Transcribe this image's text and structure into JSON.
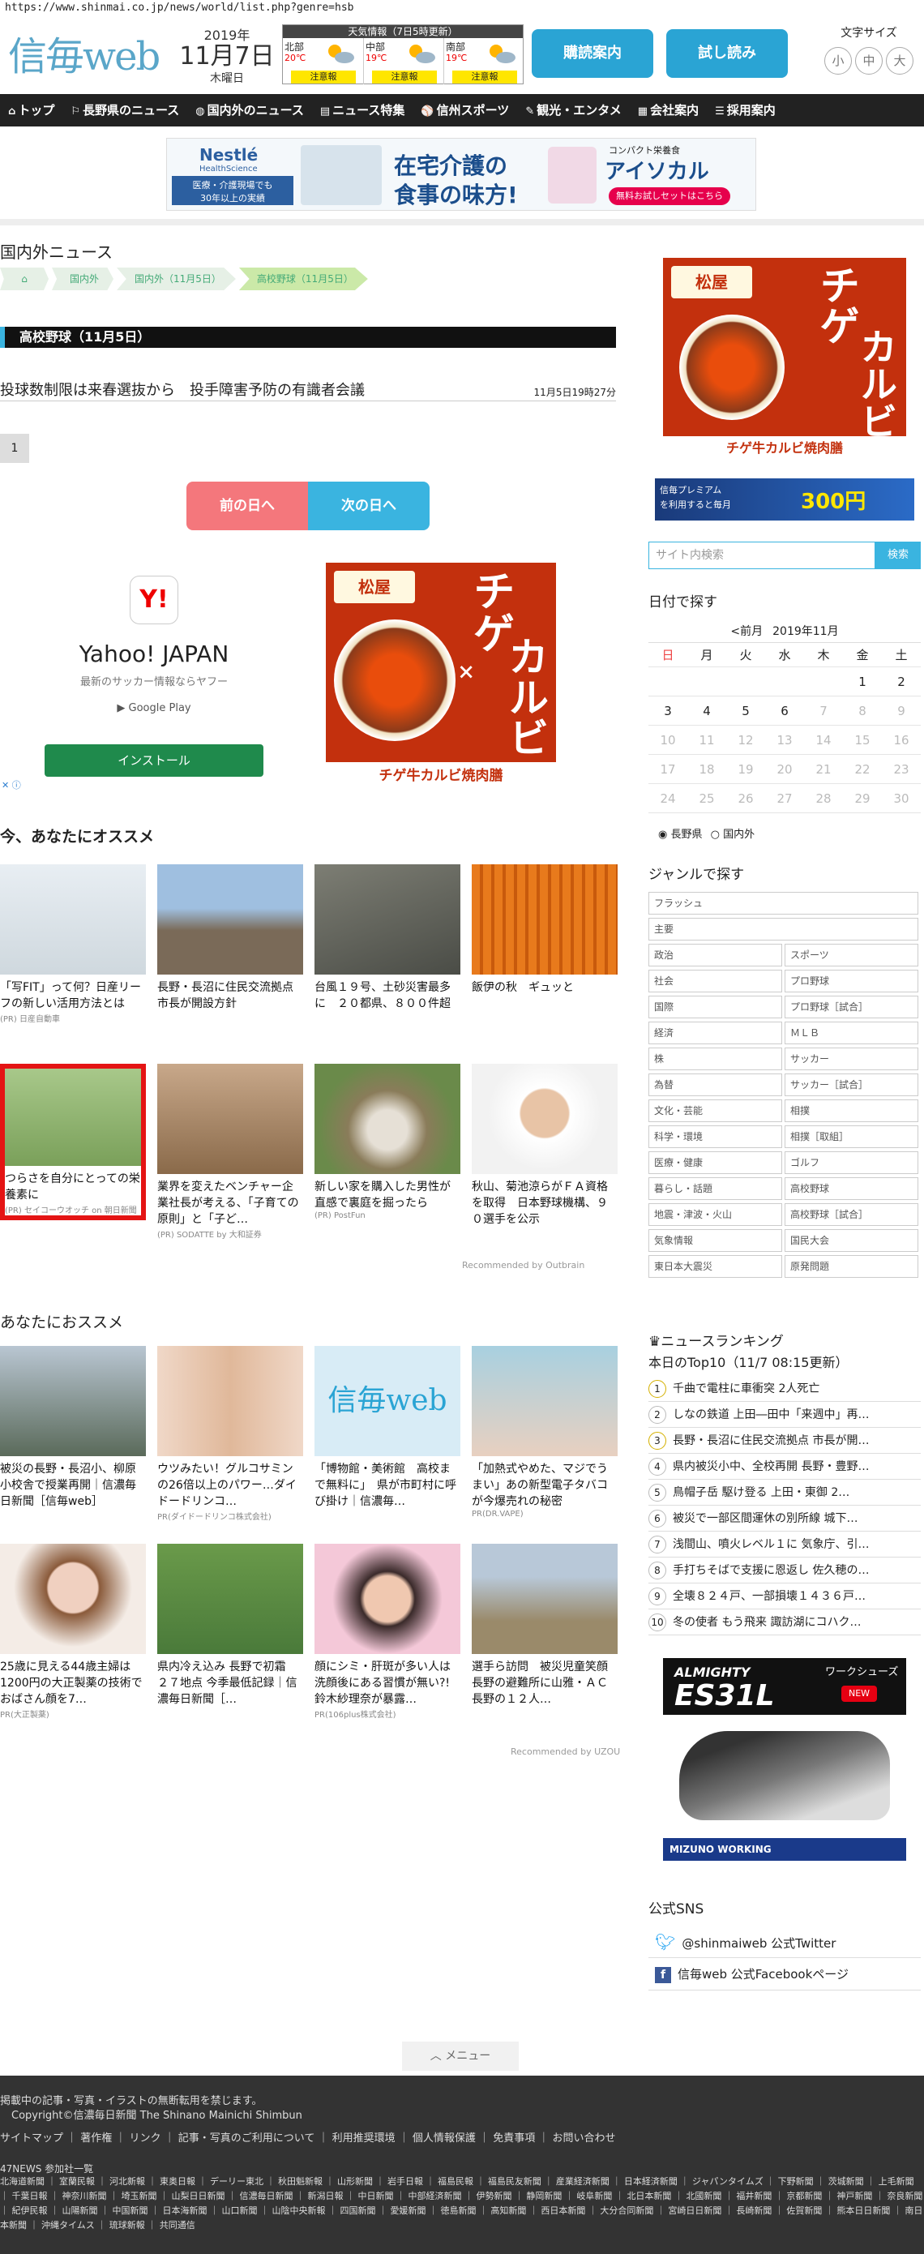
{
  "url": "https://www.shinmai.co.jp/news/world/list.php?genre=hsb",
  "header": {
    "logo": "信毎web",
    "year": "2019年",
    "date": "11月7日",
    "weekday": "木曜日",
    "weather_title": "天気情報（7日5時更新）",
    "regions": [
      {
        "name": "北部",
        "temp": "20℃",
        "warn": "注意報"
      },
      {
        "name": "中部",
        "temp": "19℃",
        "warn": "注意報"
      },
      {
        "name": "南部",
        "temp": "19℃",
        "warn": "注意報"
      }
    ],
    "btn_subscribe": "購読案内",
    "btn_trial": "試し読み",
    "font_label": "文字サイズ",
    "font_sizes": [
      "小",
      "中",
      "大"
    ]
  },
  "nav": [
    {
      "icon": "home-icon",
      "glyph": "⌂",
      "label": "トップ"
    },
    {
      "icon": "pin-icon",
      "glyph": "⚐",
      "label": "長野県のニュース"
    },
    {
      "icon": "globe-icon",
      "glyph": "◍",
      "label": "国内外のニュース"
    },
    {
      "icon": "doc-icon",
      "glyph": "▤",
      "label": "ニュース特集"
    },
    {
      "icon": "baseball-icon",
      "glyph": "⚾",
      "label": "信州スポーツ"
    },
    {
      "icon": "tour-icon",
      "glyph": "✎",
      "label": "観光・エンタメ"
    },
    {
      "icon": "building-icon",
      "glyph": "▦",
      "label": "会社案内"
    },
    {
      "icon": "recruit-icon",
      "glyph": "☰",
      "label": "採用案内"
    }
  ],
  "top_ad": {
    "brand": "Nestlé",
    "sub": "HealthScience",
    "tag1": "医療・介護現場でも",
    "tag2": "30年以上の実績",
    "headline1": "在宅介護の",
    "headline2": "食事の味方!",
    "product_tag": "コンパクト栄養食",
    "product": "アイソカル",
    "cta": "無料お試しセットはこちら"
  },
  "section_title": "国内外ニュース",
  "breadcrumbs": [
    "トップ",
    "国内外",
    "国内外（11月5日）",
    "高校野球（11月5日）"
  ],
  "category_bar": "高校野球（11月5日）",
  "article": {
    "title": "投球数制限は来春選抜から　投手障害予防の有識者会議",
    "datetime": "11月5日19時27分"
  },
  "pagination": [
    "1"
  ],
  "day_nav": {
    "prev": "前の日へ",
    "next": "次の日へ"
  },
  "yahoo_ad": {
    "logo": "Y!",
    "name": "Yahoo! JAPAN",
    "sub": "最新のサッカー情報ならヤフー",
    "store": "▶ Google Play",
    "install": "インストール"
  },
  "matsuya_ad": {
    "logo": "松屋",
    "big1": "チゲ",
    "big2": "カルビ",
    "x": "×",
    "banner": "チゲ牛カルビ焼肉膳"
  },
  "osusume": {
    "title": "今、あなたにオススメ",
    "cards": [
      {
        "title": "「写FIT」って何？日産リーフの新しい活用方法とは",
        "pr": "(PR) 日産自動車"
      },
      {
        "title": "長野・長沼に住民交流拠点　市長が開設方針",
        "pr": ""
      },
      {
        "title": "台風１９号、土砂災害最多に　２０都県、８００件超",
        "pr": ""
      },
      {
        "title": "飯伊の秋　ギュッと",
        "pr": ""
      },
      {
        "title": "つらさを自分にとっての栄養素に",
        "pr": "(PR) セイコーウオッチ on 朝日新聞"
      },
      {
        "title": "業界を変えたベンチャー企業社長が考える、「子育ての原則」と「子ど…",
        "pr": "(PR) SODATTE by 大和証券"
      },
      {
        "title": "新しい家を購入した男性が直感で裏庭を掘ったら",
        "pr": "(PR) PostFun"
      },
      {
        "title": "秋山、菊池涼らがＦＡ資格を取得　日本野球機構、９０選手を公示",
        "pr": ""
      }
    ],
    "recommended_by": "Recommended by Outbrain"
  },
  "anata": {
    "title": "あなたにおススメ",
    "cards": [
      {
        "title": "被災の長野・長沼小、柳原小校舎で授業再開｜信濃毎日新聞［信毎web］",
        "pr": ""
      },
      {
        "title": "ウツみたい！グルコサミンの26倍以上のパワー…ダイドードリンコ…",
        "pr": "PR(ダイドードリンコ株式会社)"
      },
      {
        "title": "「博物館・美術館　高校まで無料に」　県が市町村に呼び掛け｜信濃毎…",
        "pr": ""
      },
      {
        "title": "「加熱式やめた、マジでうまい」あの新型電子タバコが今爆売れの秘密",
        "pr": "PR(DR.VAPE)"
      },
      {
        "title": "25歳に見える44歳主婦は1200円の大正製薬の技術でおばさん顔を7…",
        "pr": "PR(大正製薬)"
      },
      {
        "title": "県内冷え込み 長野で初霜　２７地点 今季最低記録｜信濃毎日新聞［…",
        "pr": ""
      },
      {
        "title": "顔にシミ・肝斑が多い人は洗顔後にある習慣が無い?!鈴木紗理奈が暴露…",
        "pr": "PR(106plus株式会社)"
      },
      {
        "title": "選手ら訪問　被災児童笑顔　長野の避難所に山雅・ＡＣ長野の１２人…",
        "pr": ""
      }
    ],
    "recommended_by": "Recommended by UZOU"
  },
  "side": {
    "premium": {
      "text": "信毎プレミアム",
      "sub": "を利用すると毎月",
      "amount": "300円"
    },
    "search_placeholder": "サイト内検索",
    "search_btn": "検索",
    "cal_title": "日付で探す",
    "cal_prev": "<前月",
    "cal_month": "2019年11月",
    "weekdays": [
      "日",
      "月",
      "火",
      "水",
      "木",
      "金",
      "土"
    ],
    "weeks": [
      [
        "",
        "",
        "",
        "",
        "",
        "1",
        "2"
      ],
      [
        "3",
        "4",
        "5",
        "6",
        "7",
        "8",
        "9"
      ],
      [
        "10",
        "11",
        "12",
        "13",
        "14",
        "15",
        "16"
      ],
      [
        "17",
        "18",
        "19",
        "20",
        "21",
        "22",
        "23"
      ],
      [
        "24",
        "25",
        "26",
        "27",
        "28",
        "29",
        "30"
      ]
    ],
    "radios": [
      "長野県",
      "国内外"
    ],
    "genre_title": "ジャンルで探す",
    "genres_full": [
      "フラッシュ",
      "主要"
    ],
    "genres": [
      "政治",
      "スポーツ",
      "社会",
      "プロ野球",
      "国際",
      "プロ野球［試合］",
      "経済",
      "ＭＬＢ",
      "株",
      "サッカー",
      "為替",
      "サッカー［試合］",
      "文化・芸能",
      "相撲",
      "科学・環境",
      "相撲［取組］",
      "医療・健康",
      "ゴルフ",
      "暮らし・話題",
      "高校野球",
      "地震・津波・火山",
      "高校野球［試合］",
      "気象情報",
      "国民大会",
      "東日本大震災",
      "原発問題"
    ],
    "ranking_title": "ニュースランキング",
    "ranking_sub": "本日のTop10（11/7 08:15更新）",
    "ranking": [
      "千曲で電柱に車衝突 2人死亡",
      "しなの鉄道 上田―田中「来週中」再…",
      "長野・長沼に住民交流拠点 市長が開…",
      "県内被災小中、全校再開 長野・豊野…",
      "鳥帽子岳 駆け登る 上田・東御 2…",
      "被災で一部区間運休の別所線 城下…",
      "浅間山、噴火レベル１に 気象庁、引…",
      "手打ちそばで支援に恩返し 佐久穂の…",
      "全壊８２４戸、一部損壊１４３６戸…",
      "冬の使者 もう飛来 諏訪湖にコハク…"
    ],
    "shoe_ad": {
      "brand": "ALMIGHTY",
      "model": "ES31L",
      "tag": "ワークシューズ",
      "new": "NEW",
      "maker": "MIZUNO WORKING"
    },
    "sns_title": "公式SNS",
    "twitter": "@shinmaiweb 公式Twitter",
    "facebook": "信毎web 公式Facebookページ"
  },
  "menu": "メニュー",
  "footer": {
    "notice": "掲載中の記事・写真・イラストの無断転用を禁じます。",
    "copyright": "Copyright©信濃毎日新聞 The Shinano Mainichi Shimbun",
    "links": "サイトマップ ｜ 著作権 ｜ リンク ｜ 記事・写真のご利用について ｜ 利用推奨環境 ｜ 個人情報保護 ｜ 免責事項 ｜ お問い合わせ",
    "news47": "47NEWS 参加社一覧",
    "papers": "北海道新聞 ｜ 室蘭民報 ｜ 河北新報 ｜ 東奥日報 ｜ デーリー東北 ｜ 秋田魁新報 ｜ 山形新聞 ｜ 岩手日報 ｜ 福島民報 ｜ 福島民友新聞 ｜ 産業経済新聞 ｜ 日本経済新聞 ｜ ジャパンタイムズ ｜ 下野新聞 ｜ 茨城新聞 ｜ 上毛新聞 ｜ 千葉日報 ｜ 神奈川新聞 ｜ 埼玉新聞 ｜ 山梨日日新聞 ｜ 信濃毎日新聞 ｜ 新潟日報 ｜ 中日新聞 ｜ 中部経済新聞 ｜ 伊勢新聞 ｜ 静岡新聞 ｜ 岐阜新聞 ｜ 北日本新聞 ｜ 北國新聞 ｜ 福井新聞 ｜ 京都新聞 ｜ 神戸新聞 ｜ 奈良新聞 ｜ 紀伊民報 ｜ 山陽新聞 ｜ 中国新聞 ｜ 日本海新聞 ｜ 山口新聞 ｜ 山陰中央新報 ｜ 四国新聞 ｜ 愛媛新聞 ｜ 徳島新聞 ｜ 高知新聞 ｜ 西日本新聞 ｜ 大分合同新聞 ｜ 宮崎日日新聞 ｜ 長崎新聞 ｜ 佐賀新聞 ｜ 熊本日日新聞 ｜ 南日本新聞 ｜ 沖縄タイムス ｜ 琉球新報 ｜ 共同通信"
  }
}
